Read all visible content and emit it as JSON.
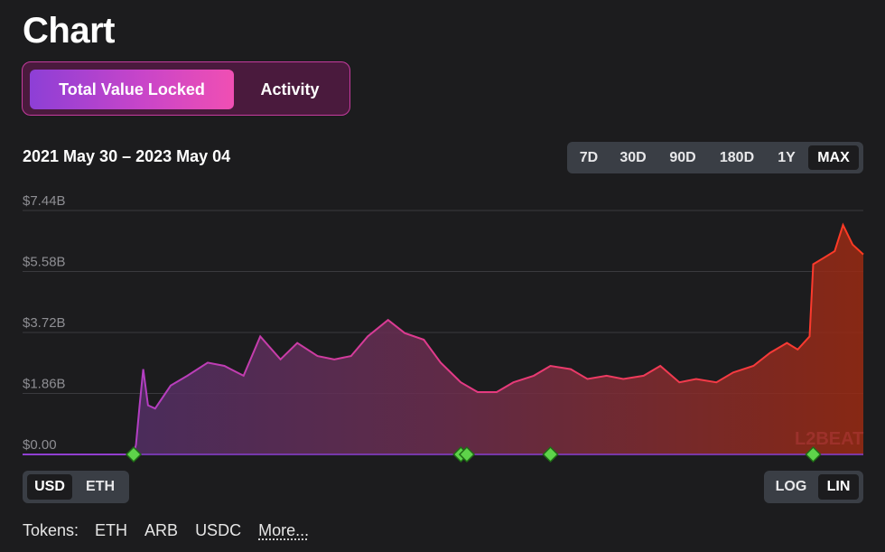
{
  "page": {
    "title": "Chart"
  },
  "toggle": {
    "tvl_label": "Total Value Locked",
    "activity_label": "Activity"
  },
  "date_range": "2021 May 30 – 2023 May 04",
  "ranges": [
    "7D",
    "30D",
    "90D",
    "180D",
    "1Y",
    "MAX"
  ],
  "selected_range": "MAX",
  "currency": {
    "usd": "USD",
    "eth": "ETH",
    "selected": "USD"
  },
  "scale": {
    "log": "LOG",
    "lin": "LIN",
    "selected": "LIN"
  },
  "tokens": {
    "label": "Tokens:",
    "items": [
      "ETH",
      "ARB",
      "USDC"
    ],
    "more": "More..."
  },
  "watermark": "L2BEAT",
  "colors": {
    "gradient_start": "#8d3fd6",
    "gradient_end": "#f04fb3",
    "line_start": "#a040d8",
    "line_end": "#ff3a20",
    "event_marker": "#5ed34a"
  },
  "chart_data": {
    "type": "area",
    "title": "",
    "xlabel": "",
    "ylabel": "",
    "y_tick_labels": [
      "$7.44B",
      "$5.58B",
      "$3.72B",
      "$1.86B",
      "$0.00"
    ],
    "ylim": [
      0,
      7.44
    ],
    "y_unit": "B USD",
    "grid": true,
    "x": [
      "2021-05-30",
      "2021-07-01",
      "2021-08-01",
      "2021-08-31",
      "2021-09-02",
      "2021-09-05",
      "2021-09-08",
      "2021-09-12",
      "2021-09-18",
      "2021-10-01",
      "2021-10-15",
      "2021-11-01",
      "2021-11-15",
      "2021-12-01",
      "2021-12-15",
      "2022-01-01",
      "2022-01-15",
      "2022-02-01",
      "2022-02-15",
      "2022-03-01",
      "2022-03-15",
      "2022-04-01",
      "2022-04-15",
      "2022-05-01",
      "2022-05-15",
      "2022-06-01",
      "2022-06-15",
      "2022-07-01",
      "2022-07-15",
      "2022-08-01",
      "2022-08-15",
      "2022-09-01",
      "2022-09-15",
      "2022-10-01",
      "2022-10-15",
      "2022-11-01",
      "2022-11-15",
      "2022-12-01",
      "2022-12-15",
      "2023-01-01",
      "2023-01-15",
      "2023-02-01",
      "2023-02-15",
      "2023-03-01",
      "2023-03-10",
      "2023-03-20",
      "2023-03-23",
      "2023-04-01",
      "2023-04-10",
      "2023-04-17",
      "2023-04-25",
      "2023-05-04"
    ],
    "series": [
      {
        "values": [
          0,
          0,
          0,
          0,
          0.3,
          1.5,
          2.6,
          1.5,
          1.4,
          2.1,
          2.4,
          2.8,
          2.7,
          2.4,
          3.6,
          2.9,
          3.4,
          3.0,
          2.9,
          3.0,
          3.6,
          4.1,
          3.7,
          3.5,
          2.8,
          2.2,
          1.9,
          1.9,
          2.2,
          2.4,
          2.7,
          2.6,
          2.3,
          2.4,
          2.3,
          2.4,
          2.7,
          2.2,
          2.3,
          2.2,
          2.5,
          2.7,
          3.1,
          3.4,
          3.2,
          3.6,
          5.8,
          6.0,
          6.2,
          7.0,
          6.4,
          6.1
        ]
      }
    ],
    "event_markers": [
      "2021-08-31",
      "2022-06-01",
      "2022-06-06",
      "2022-08-15",
      "2023-03-23"
    ]
  }
}
